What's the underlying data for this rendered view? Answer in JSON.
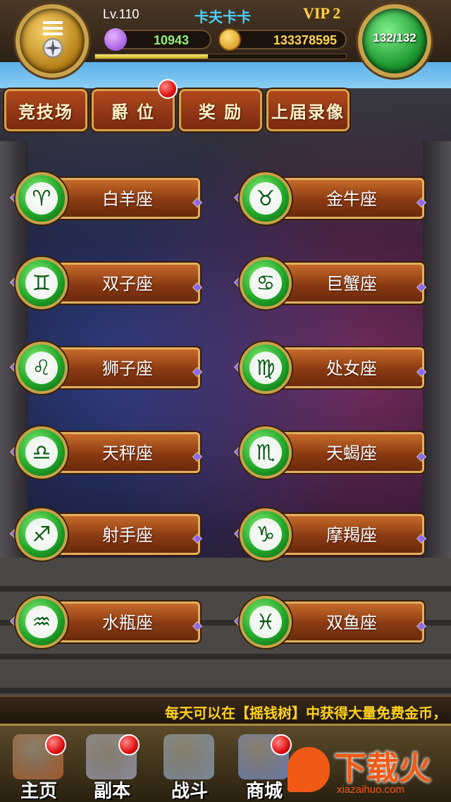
{
  "header": {
    "level": "Lv.110",
    "player_name": "卡夫卡卡",
    "vip": "VIP 2",
    "gems": "10943",
    "gold": "133378595",
    "energy": "132/132",
    "xp_fraction": 0.45
  },
  "tabs": [
    {
      "label": "竞技场",
      "badge": false
    },
    {
      "label": "爵 位",
      "badge": true
    },
    {
      "label": "奖 励",
      "badge": false
    },
    {
      "label": "上届录像",
      "badge": false
    }
  ],
  "zodiac": [
    {
      "label": "白羊座",
      "symbol": "♈"
    },
    {
      "label": "金牛座",
      "symbol": "♉"
    },
    {
      "label": "双子座",
      "symbol": "♊"
    },
    {
      "label": "巨蟹座",
      "symbol": "♋"
    },
    {
      "label": "狮子座",
      "symbol": "♌"
    },
    {
      "label": "处女座",
      "symbol": "♍"
    },
    {
      "label": "天秤座",
      "symbol": "♎"
    },
    {
      "label": "天蝎座",
      "symbol": "♏"
    },
    {
      "label": "射手座",
      "symbol": "♐"
    },
    {
      "label": "摩羯座",
      "symbol": "♑"
    },
    {
      "label": "水瓶座",
      "symbol": "♒"
    },
    {
      "label": "双鱼座",
      "symbol": "♓"
    }
  ],
  "tip": "每天可以在【摇钱树】中获得大量免费金币，",
  "nav": [
    {
      "label": "主页",
      "icon": "house-icon",
      "badge": true
    },
    {
      "label": "副本",
      "icon": "skull-icon",
      "badge": true
    },
    {
      "label": "战斗",
      "icon": "swords-icon",
      "badge": false
    },
    {
      "label": "商城",
      "icon": "shop-icon",
      "badge": true
    }
  ],
  "watermark": {
    "main": "下载火",
    "sub": "xiazaihuo.com"
  },
  "colors": {
    "name": "#4ad0ff",
    "vip": "#ffd54a",
    "gems": "#8ef07a",
    "gold": "#ffd54a",
    "tip": "#ffd21a",
    "tab": "#b0481e",
    "zodiac_orb": "#22a82a"
  }
}
